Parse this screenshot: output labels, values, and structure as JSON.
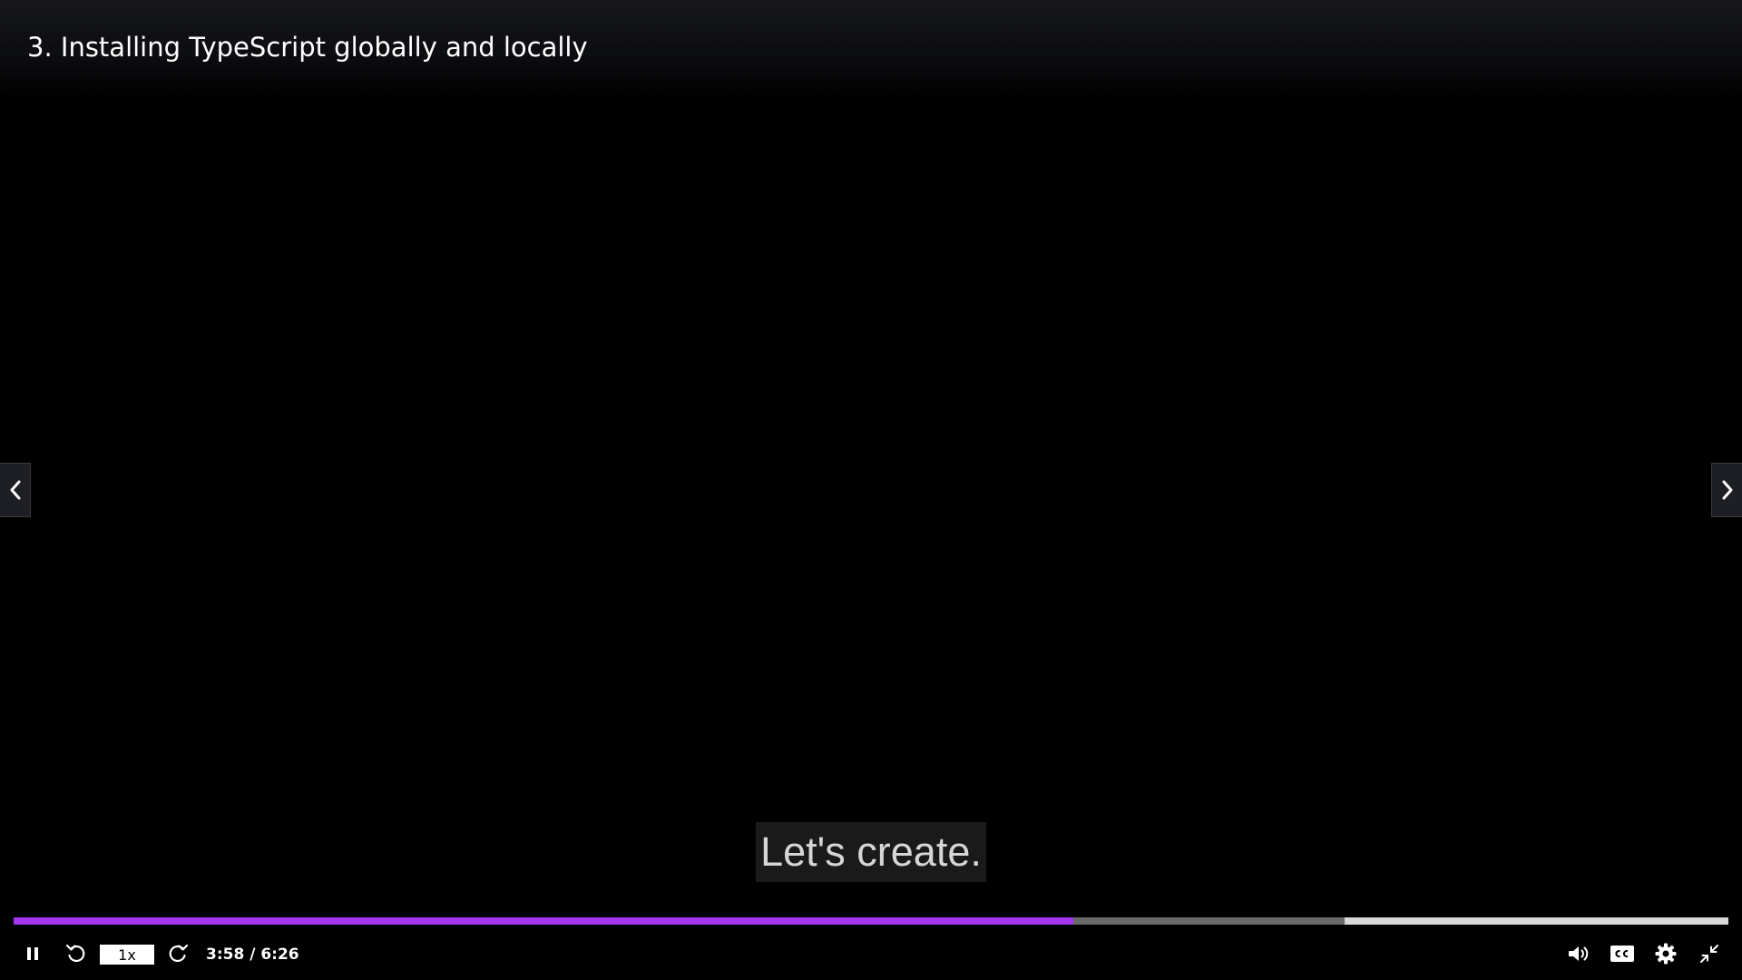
{
  "video": {
    "title": "3. Installing TypeScript globally and locally",
    "caption": "Let's create."
  },
  "playback": {
    "speed": "1x",
    "current_time": "3:58",
    "duration": "6:26",
    "time_display": "3:58 / 6:26",
    "played_fraction": 0.618,
    "buffered_fraction": 0.776,
    "accent_color": "#a435f0"
  },
  "icons": {
    "prev": "chevron-left-icon",
    "next": "chevron-right-icon",
    "play_pause": "pause-icon",
    "rewind": "rewind-5-icon",
    "forward": "forward-5-icon",
    "volume": "volume-icon",
    "captions": "closed-captions-icon",
    "settings": "gear-icon",
    "exit_fullscreen": "exit-fullscreen-icon"
  }
}
